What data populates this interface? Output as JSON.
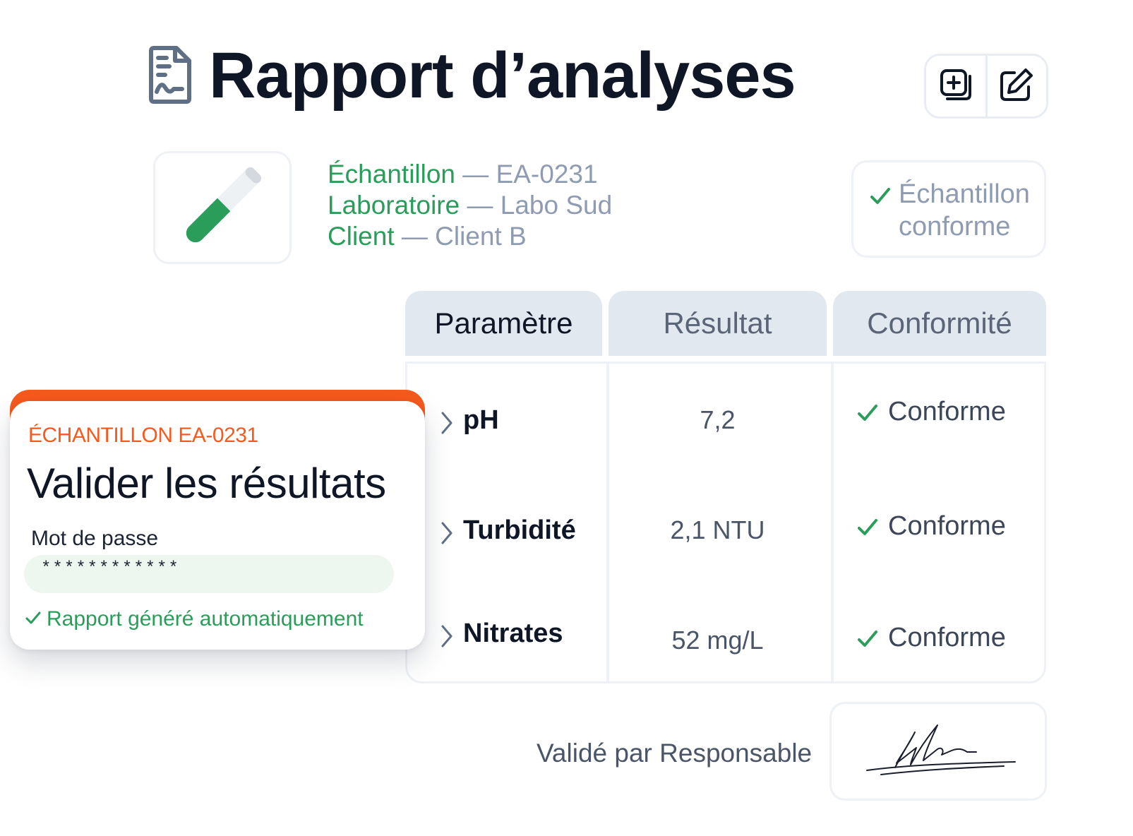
{
  "header": {
    "title": "Rapport d’analyses",
    "icons": [
      "document-chart-icon",
      "duplicate-icon",
      "edit-icon"
    ]
  },
  "sample": {
    "rows": [
      {
        "label": "Échantillon",
        "separator": " — ",
        "value": "EA-0231"
      },
      {
        "label": "Laboratoire",
        "separator": " — ",
        "value": "Labo Sud"
      },
      {
        "label": "Client",
        "separator": " — ",
        "value": "Client B"
      }
    ],
    "icon": "test-tube-icon",
    "status": "Échantillon conforme"
  },
  "table": {
    "headers": [
      "Paramètre",
      "Résultat",
      "Conformité"
    ],
    "rows": [
      {
        "param": "pH",
        "result": "7,2",
        "conformity": "Conforme"
      },
      {
        "param": "Turbidité",
        "result": "2,1 NTU",
        "conformity": "Conforme"
      },
      {
        "param": "Nitrates",
        "result": "52 mg/L",
        "conformity": "Conforme"
      }
    ]
  },
  "signature": {
    "validated_by": "Validé par Responsable"
  },
  "modal": {
    "kicker": "ÉCHANTILLON EA-0231",
    "title": "Valider les résultats",
    "password_label": "Mot de passe",
    "password_value": "************",
    "note": "Rapport généré automatiquement"
  },
  "colors": {
    "accent_orange": "#f65a1d",
    "success_green": "#2a9d5b",
    "header_bg": "#e2e8f0",
    "muted_text": "#8f9bb0"
  }
}
